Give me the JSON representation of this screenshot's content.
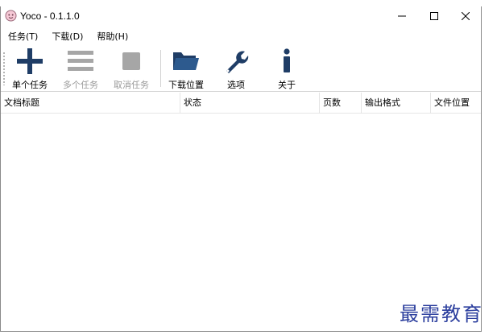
{
  "window": {
    "title": "Yoco - 0.1.1.0"
  },
  "menu": [
    {
      "label": "任务(T)"
    },
    {
      "label": "下载(D)"
    },
    {
      "label": "帮助(H)"
    }
  ],
  "toolbar": {
    "buttons": [
      {
        "label": "单个任务",
        "icon": "plus-icon",
        "enabled": true
      },
      {
        "label": "多个任务",
        "icon": "list-icon",
        "enabled": false
      },
      {
        "label": "取消任务",
        "icon": "stop-icon",
        "enabled": false
      },
      {
        "label": "下载位置",
        "icon": "folder-icon",
        "enabled": true
      },
      {
        "label": "选项",
        "icon": "wrench-icon",
        "enabled": true
      },
      {
        "label": "关于",
        "icon": "info-icon",
        "enabled": true
      }
    ]
  },
  "table": {
    "columns": [
      "文档标题",
      "状态",
      "页数",
      "输出格式",
      "文件位置"
    ],
    "rows": []
  },
  "watermark": "最需教育",
  "colors": {
    "accent": "#1f3d66",
    "disabled": "#a6a6a6",
    "watermark": "#2c3f9e"
  }
}
